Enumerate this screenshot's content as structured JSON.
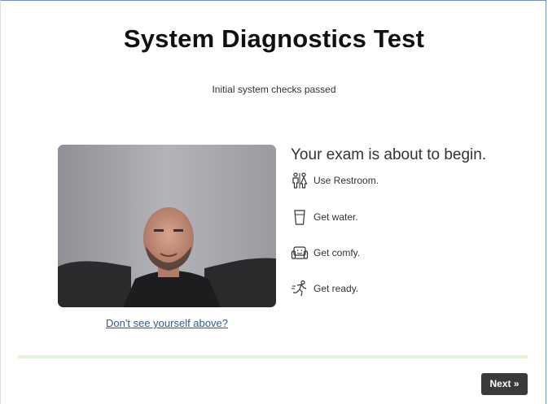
{
  "page": {
    "title": "System Diagnostics Test",
    "status": "Initial system checks passed"
  },
  "camera": {
    "help_link": "Don't see yourself above?"
  },
  "checklist": {
    "heading": "Your exam is about to begin.",
    "items": [
      {
        "icon": "restroom-icon",
        "label": "Use Restroom."
      },
      {
        "icon": "water-glass-icon",
        "label": "Get water."
      },
      {
        "icon": "armchair-icon",
        "label": "Get comfy."
      },
      {
        "icon": "runner-icon",
        "label": "Get ready."
      }
    ]
  },
  "footer": {
    "next_label": "Next »"
  },
  "colors": {
    "link": "#2c5a9e",
    "button_bg": "#3a3a3a",
    "divider": "#e6f4dc"
  }
}
